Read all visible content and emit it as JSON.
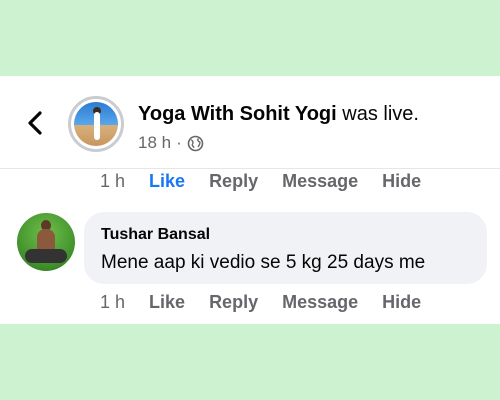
{
  "post": {
    "page_name": "Yoga With Sohit Yogi",
    "status_text": "was live.",
    "time": "18 h",
    "separator": "·"
  },
  "icons": {
    "back": "chevron-left-icon",
    "audience": "globe-icon"
  },
  "previous_comment_actions": {
    "time": "1 h",
    "like": "Like",
    "reply": "Reply",
    "message": "Message",
    "hide": "Hide",
    "like_state": "liked",
    "like_color": "#1877f2"
  },
  "comment": {
    "author": "Tushar Bansal",
    "text": "Mene aap ki vedio se 5 kg 25 days me",
    "actions": {
      "time": "1 h",
      "like": "Like",
      "reply": "Reply",
      "message": "Message",
      "hide": "Hide"
    }
  },
  "colors": {
    "background": "#cdf2cf",
    "card": "#ffffff",
    "bubble": "#f0f2f5",
    "secondary_text": "#65676b"
  }
}
